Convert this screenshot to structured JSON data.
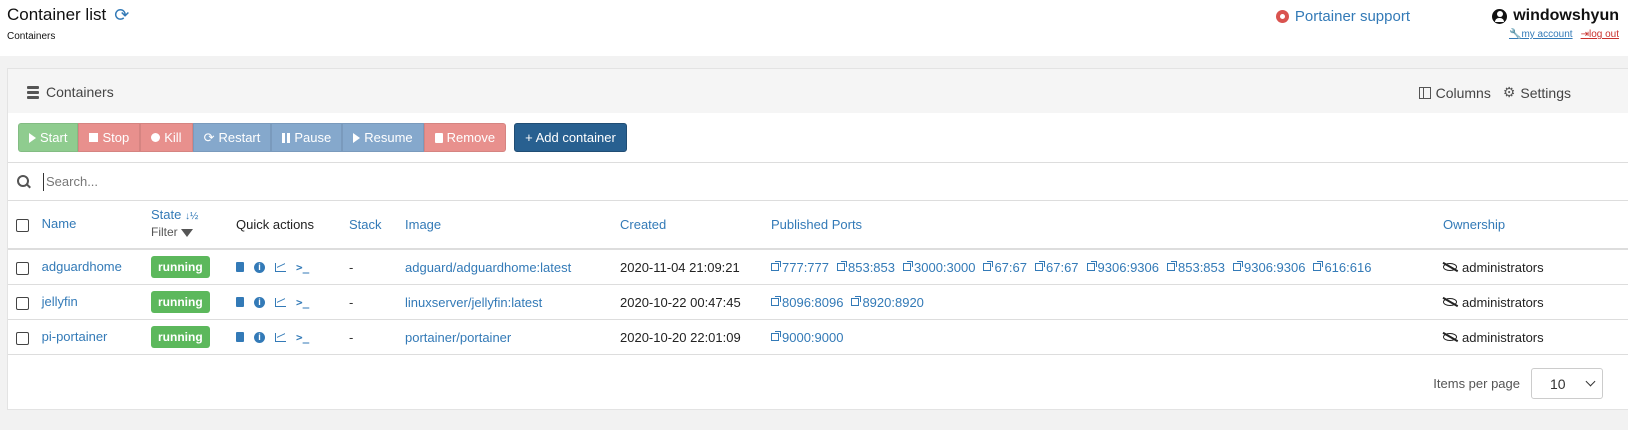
{
  "header": {
    "title": "Container list",
    "subtitle": "Containers",
    "support_label": "Portainer support",
    "username": "windowshyun",
    "my_account": "my account",
    "log_out": "log out"
  },
  "widget": {
    "title": "Containers",
    "columns_label": "Columns",
    "settings_label": "Settings"
  },
  "toolbar": {
    "start": "Start",
    "stop": "Stop",
    "kill": "Kill",
    "restart": "Restart",
    "pause": "Pause",
    "resume": "Resume",
    "remove": "Remove",
    "add_container": "+ Add container"
  },
  "search": {
    "placeholder": "Search..."
  },
  "table": {
    "headers": {
      "name": "Name",
      "state": "State",
      "state_sort": "↓½",
      "filter": "Filter",
      "quick_actions": "Quick actions",
      "stack": "Stack",
      "image": "Image",
      "created": "Created",
      "ports": "Published Ports",
      "ownership": "Ownership"
    },
    "rows": [
      {
        "name": "adguardhome",
        "state": "running",
        "stack": "-",
        "image": "adguard/adguardhome:latest",
        "created": "2020-11-04 21:09:21",
        "ports": [
          "777:777",
          "853:853",
          "3000:3000",
          "67:67",
          "67:67",
          "9306:9306",
          "853:853",
          "9306:9306",
          "616:616"
        ],
        "ownership": "administrators"
      },
      {
        "name": "jellyfin",
        "state": "running",
        "stack": "-",
        "image": "linuxserver/jellyfin:latest",
        "created": "2020-10-22 00:47:45",
        "ports": [
          "8096:8096",
          "8920:8920"
        ],
        "ownership": "administrators"
      },
      {
        "name": "pi-portainer",
        "state": "running",
        "stack": "-",
        "image": "portainer/portainer",
        "created": "2020-10-20 22:01:09",
        "ports": [
          "9000:9000"
        ],
        "ownership": "administrators"
      }
    ]
  },
  "footer": {
    "items_per_page_label": "Items per page",
    "items_per_page_value": "10"
  },
  "colors": {
    "link": "#337ab7",
    "running_badge": "#5cb85c",
    "add_button": "#286090",
    "danger": "#d9534f"
  }
}
